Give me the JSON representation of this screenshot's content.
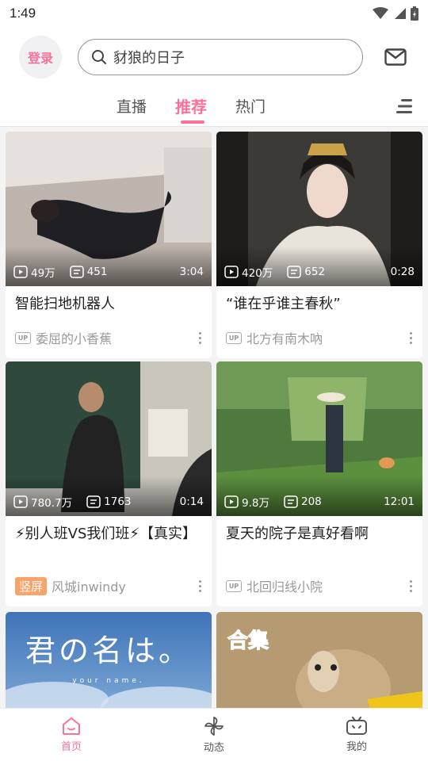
{
  "status_bar": {
    "time": "1:49"
  },
  "header": {
    "login_label": "登录",
    "search_placeholder": "豺狼的日子"
  },
  "tabs": [
    {
      "label": "直播"
    },
    {
      "label": "推荐"
    },
    {
      "label": "热门"
    }
  ],
  "feed": [
    {
      "title": "智能扫地机器人",
      "views": "49万",
      "comments": "451",
      "duration": "3:04",
      "author": "委屈的小香蕉",
      "badge": "UP"
    },
    {
      "title": "“谁在乎谁主春秋”",
      "views": "420万",
      "comments": "652",
      "duration": "0:28",
      "author": "北方有南木吶",
      "badge": "UP"
    },
    {
      "title": "⚡别人班VS我们班⚡【真实】",
      "views": "780.7万",
      "comments": "1763",
      "duration": "0:14",
      "author": "风城inwindy",
      "badge": "竖屏"
    },
    {
      "title": "夏天的院子是真好看啊",
      "views": "9.8万",
      "comments": "208",
      "duration": "12:01",
      "author": "北回归线小院",
      "badge": "UP"
    },
    {
      "thumb_text": "君の名は。",
      "thumb_subtext": "your name."
    },
    {
      "thumb_text": "合集"
    }
  ],
  "bottom_nav": [
    {
      "label": "首页",
      "icon": "home-icon"
    },
    {
      "label": "动态",
      "icon": "pinwheel-icon"
    },
    {
      "label": "我的",
      "icon": "tv-icon"
    }
  ],
  "colors": {
    "accent": "#fb7299",
    "vertical_badge": "#f9a269"
  }
}
